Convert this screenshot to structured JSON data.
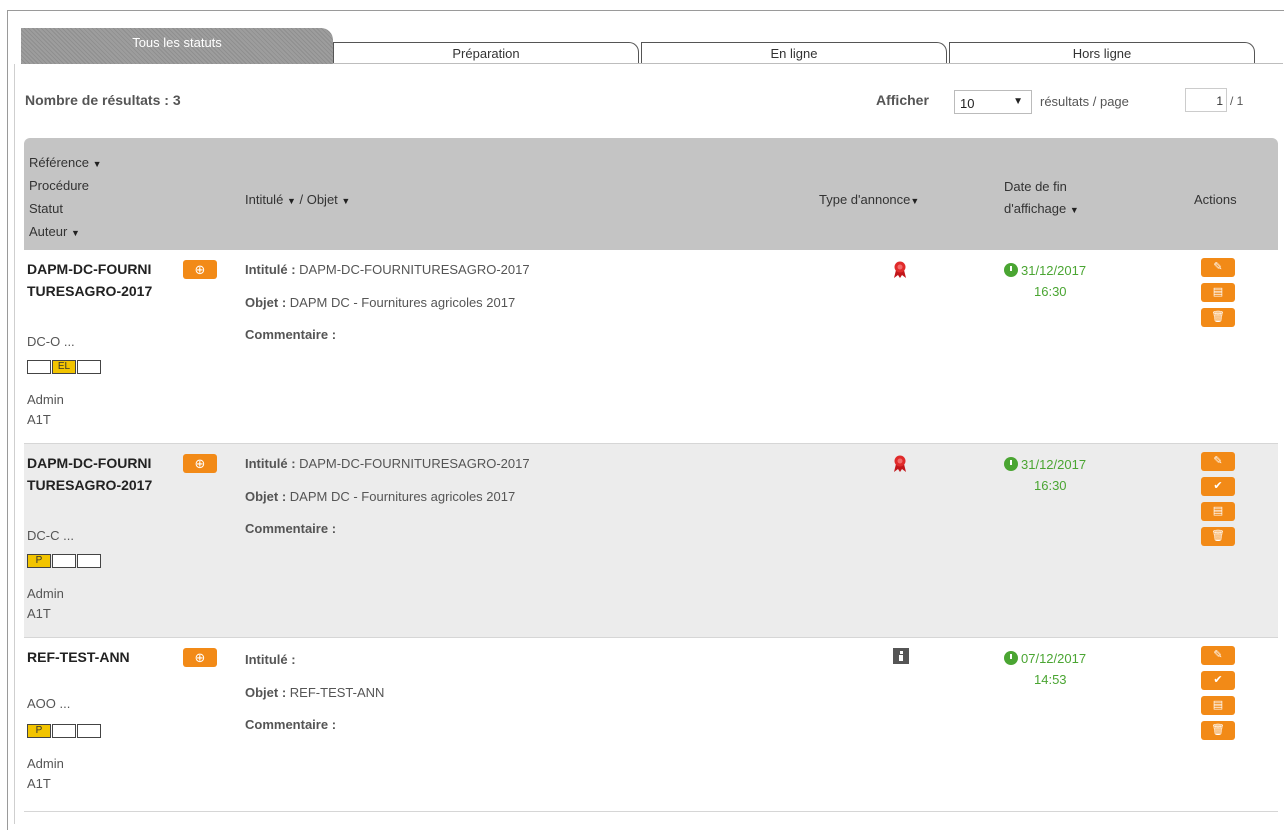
{
  "tabs": [
    {
      "label": "Tous les statuts"
    },
    {
      "label": "Préparation"
    },
    {
      "label": "En ligne"
    },
    {
      "label": "Hors ligne"
    }
  ],
  "results": {
    "count_label": "Nombre de résultats : 3",
    "show_label": "Afficher",
    "per_page_value": "10",
    "per_page_suffix": "résultats / page",
    "page_current": "1",
    "page_total": "/ 1"
  },
  "table": {
    "headers": {
      "reference": "Référence",
      "procedure": "Procédure",
      "statut": "Statut",
      "auteur": "Auteur",
      "intitule": "Intitulé",
      "objet": "/ Objet",
      "type_annonce": "Type d'annonce",
      "date_fin_1": "Date de fin",
      "date_fin_2": "d'affichage",
      "actions": "Actions"
    },
    "labels": {
      "intitule": "Intitulé :",
      "objet": "Objet :",
      "commentaire": "Commentaire :"
    },
    "rows": [
      {
        "reference": "DAPM-DC-FOURNITURESAGRO-2017",
        "procedure": "DC-O ...",
        "status_boxes": [
          "",
          "EL",
          ""
        ],
        "status_active": 1,
        "author_1": "Admin",
        "author_2": "A1T",
        "intitule": "DAPM-DC-FOURNITURESAGRO-2017",
        "objet": "DAPM DC - Fournitures agricoles 2017",
        "commentaire": "",
        "type_icon": "ribbon-icon",
        "date": "31/12/2017",
        "time": "16:30",
        "actions": [
          "edit-icon",
          "book-icon",
          "trash-icon"
        ]
      },
      {
        "reference": "DAPM-DC-FOURNITURESAGRO-2017",
        "procedure": "DC-C ...",
        "status_boxes": [
          "P",
          "",
          ""
        ],
        "status_active": 0,
        "author_1": "Admin",
        "author_2": "A1T",
        "intitule": "DAPM-DC-FOURNITURESAGRO-2017",
        "objet": "DAPM DC - Fournitures agricoles 2017",
        "commentaire": "",
        "type_icon": "ribbon-icon",
        "date": "31/12/2017",
        "time": "16:30",
        "actions": [
          "edit-icon",
          "check-icon",
          "book-icon",
          "trash-icon"
        ]
      },
      {
        "reference": "REF-TEST-ANN",
        "procedure": "AOO ...",
        "status_boxes": [
          "P",
          "",
          ""
        ],
        "status_active": 0,
        "author_1": "Admin",
        "author_2": "A1T",
        "intitule": "",
        "objet": "REF-TEST-ANN",
        "commentaire": "",
        "type_icon": "info-icon",
        "date": "07/12/2017",
        "time": "14:53",
        "actions": [
          "edit-icon",
          "check-icon",
          "book-icon",
          "trash-icon"
        ]
      }
    ]
  },
  "colors": {
    "accent_orange": "#f28a17",
    "date_green": "#4aa532",
    "status_yellow": "#f2c400",
    "header_gray": "#c4c4c4"
  }
}
